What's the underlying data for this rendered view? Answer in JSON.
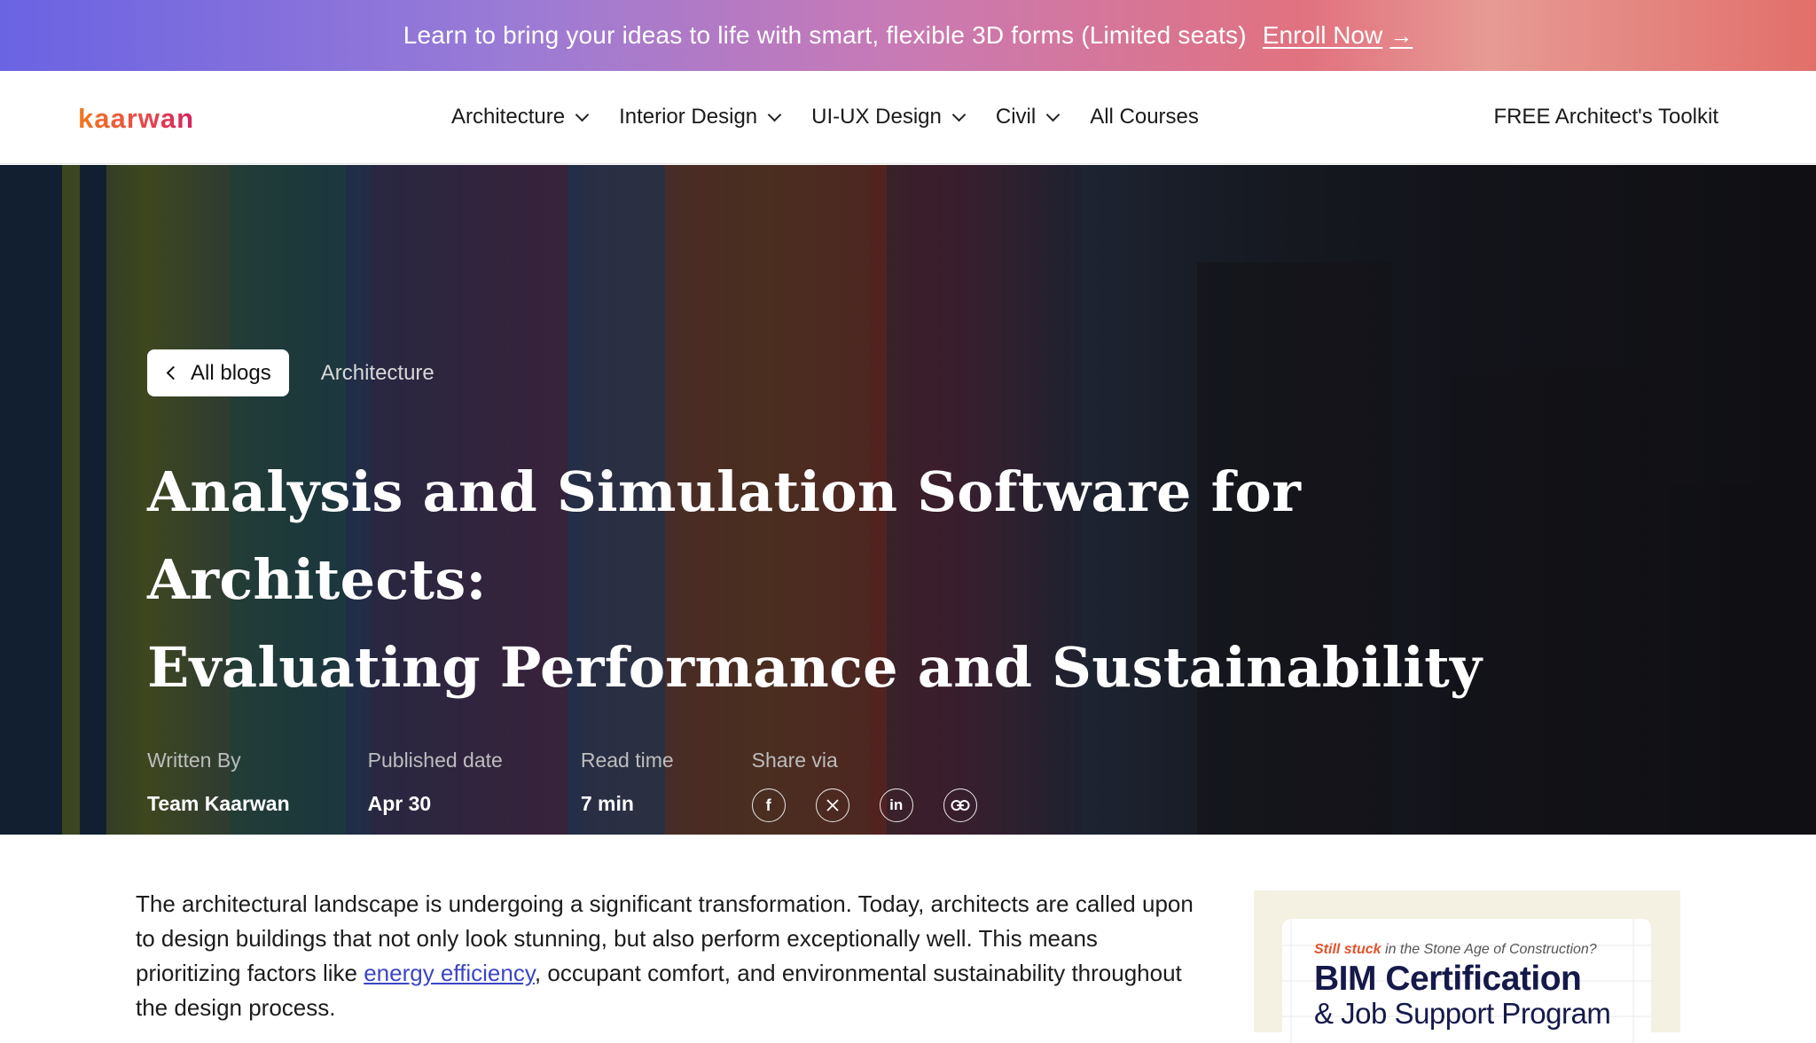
{
  "promo": {
    "text": "Learn to bring your ideas to life with smart, flexible 3D forms (Limited seats)",
    "cta": "Enroll Now",
    "cta_icon": "arrow-right-icon"
  },
  "nav": {
    "logo": "kaarwan",
    "items": [
      {
        "label": "Architecture",
        "has_dropdown": true
      },
      {
        "label": "Interior Design",
        "has_dropdown": true
      },
      {
        "label": "UI-UX Design",
        "has_dropdown": true
      },
      {
        "label": "Civil",
        "has_dropdown": true
      },
      {
        "label": "All Courses",
        "has_dropdown": false
      }
    ],
    "toolkit": "FREE Architect's Toolkit"
  },
  "hero": {
    "back_label": "All blogs",
    "category": "Architecture",
    "title_line1": "Analysis and Simulation Software for Architects:",
    "title_line2": "Evaluating Performance and Sustainability",
    "meta": {
      "written_by_label": "Written By",
      "written_by": "Team Kaarwan",
      "published_label": "Published date",
      "published": "Apr 30",
      "read_label": "Read time",
      "read": "7 min",
      "share_label": "Share via"
    },
    "share_icons": [
      "facebook-icon",
      "x-twitter-icon",
      "linkedin-icon",
      "link-icon"
    ]
  },
  "article": {
    "p1_before": "The architectural landscape is undergoing a significant transformation. Today, architects are called upon to design buildings that not only look stunning, but also perform exceptionally well. This means prioritizing factors like ",
    "p1_link": "energy efficiency",
    "p1_after": ", occupant comfort, and environmental sustainability throughout the design process."
  },
  "ad": {
    "kicker_bold": "Still stuck",
    "kicker_rest": " in the Stone Age of Construction?",
    "title": "BIM Certification",
    "subtitle": "& Job Support Program"
  },
  "colors": {
    "promo_start": "#6a63e3",
    "promo_end": "#e26f6a",
    "logo": "#e8454d",
    "link": "#3b46c4"
  }
}
